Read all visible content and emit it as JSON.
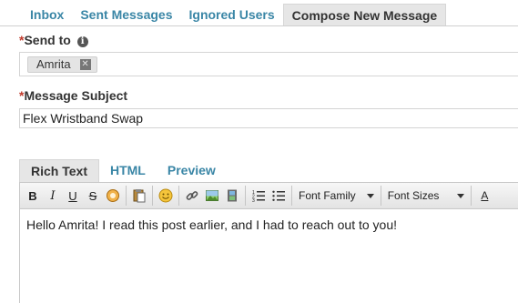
{
  "tabs": [
    {
      "label": "Inbox"
    },
    {
      "label": "Sent Messages"
    },
    {
      "label": "Ignored Users"
    },
    {
      "label": "Compose New Message"
    }
  ],
  "send_to": {
    "required_mark": "*",
    "label": "Send to",
    "recipients": [
      "Amrita"
    ]
  },
  "subject": {
    "required_mark": "*",
    "label": "Message Subject",
    "value": "Flex Wristband Swap"
  },
  "editor_tabs": [
    {
      "label": "Rich Text"
    },
    {
      "label": "HTML"
    },
    {
      "label": "Preview"
    }
  ],
  "toolbar": {
    "bold": "B",
    "italic": "I",
    "underline": "U",
    "strike": "S",
    "font_family": "Font Family",
    "font_sizes": "Font Sizes",
    "text_color": "A"
  },
  "message_body": "Hello Amrita! I read this post earlier, and I had to reach out to you!"
}
